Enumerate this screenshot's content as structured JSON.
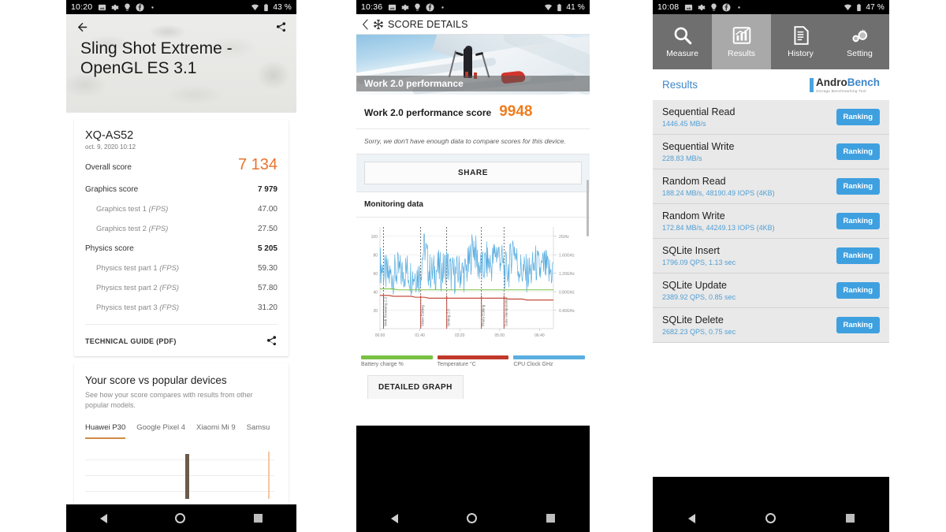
{
  "phone1": {
    "status": {
      "time": "10:20",
      "battery": "43 %",
      "icons": [
        "image-icon",
        "gear-icon",
        "bulb-icon",
        "facebook-icon",
        "dot-icon"
      ],
      "right_icons": [
        "wifi-icon",
        "battery-icon"
      ]
    },
    "appbar": {
      "back": "back-arrow-icon",
      "share": "share-icon"
    },
    "title": "Sling Shot Extreme - OpenGL ES 3.1",
    "device": {
      "name": "XQ-AS52",
      "date": "oct. 9, 2020 10:12"
    },
    "scores": [
      {
        "label": "Overall score",
        "value": "7 134",
        "type": "overall"
      },
      {
        "label": "Graphics score",
        "value": "7 979",
        "type": "main"
      },
      {
        "label": "Graphics test 1",
        "unit": "(FPS)",
        "value": "47.00",
        "type": "sub"
      },
      {
        "label": "Graphics test 2",
        "unit": "(FPS)",
        "value": "27.50",
        "type": "sub"
      },
      {
        "label": "Physics score",
        "value": "5 205",
        "type": "main"
      },
      {
        "label": "Physics test part 1",
        "unit": "(FPS)",
        "value": "59.30",
        "type": "sub"
      },
      {
        "label": "Physics test part 2",
        "unit": "(FPS)",
        "value": "57.80",
        "type": "sub"
      },
      {
        "label": "Physics test part 3",
        "unit": "(FPS)",
        "value": "31.20",
        "type": "sub"
      }
    ],
    "technical_guide": "TECHNICAL GUIDE (PDF)",
    "compare": {
      "title": "Your score vs popular devices",
      "subtitle": "See how your score compares with results from other popular models.",
      "tabs": [
        "Huawei P30",
        "Google Pixel 4",
        "Xiaomi Mi 9",
        "Samsu"
      ],
      "active_tab": "Huawei P30"
    },
    "accent": "#e8742c"
  },
  "phone2": {
    "status": {
      "time": "10:36",
      "battery": "41 %"
    },
    "appbar": {
      "back": "chevron-left-icon",
      "logo": "snowflake-icon",
      "title": "SCORE DETAILS"
    },
    "hero_caption": "Work 2.0 performance",
    "score": {
      "label": "Work 2.0 performance score",
      "value": "9948"
    },
    "note": "Sorry, we don't have enough data to compare scores for this device.",
    "share_label": "SHARE",
    "monitoring_label": "Monitoring data",
    "detailed_graph_label": "DETAILED GRAPH",
    "accent": "#f07c1e",
    "chart_data": {
      "type": "line",
      "title": "Monitoring data",
      "xlabel": "",
      "ylabel": "",
      "grid": true,
      "legend_position": "bottom",
      "x_ticks": [
        "00:00",
        "01:40",
        "03:20",
        "05:00",
        "06:40"
      ],
      "y_left_ticks": [
        20,
        40,
        60,
        80,
        100
      ],
      "y_left_range": [
        0,
        110
      ],
      "y_right_ticks": [
        "0.40GHz",
        "0.80GHz",
        "1.20GHz",
        "1.60GHz",
        "2GHz"
      ],
      "y_right_range": [
        0,
        2.2
      ],
      "annotations": [
        "Web Browsing 2.0",
        "Video Editing",
        "Writing 2.0",
        "Photo Editing",
        "Data Manipulation"
      ],
      "series": [
        {
          "name": "Battery charge %",
          "color": "#7ac143",
          "type": "step",
          "values": [
            43,
            43,
            43,
            43,
            42,
            42,
            42,
            42,
            42,
            42,
            42,
            42,
            42,
            42,
            42,
            42,
            42,
            42,
            42,
            42,
            42,
            42,
            42,
            42,
            42,
            42,
            42,
            42,
            42,
            42,
            42,
            42,
            42,
            42,
            42,
            42,
            42,
            42,
            42,
            42
          ]
        },
        {
          "name": "Temperature °C",
          "color": "#c0392b",
          "type": "step",
          "values": [
            36,
            36,
            36,
            35,
            35,
            35,
            35,
            35,
            34,
            34,
            34,
            33,
            33,
            33,
            33,
            33,
            33,
            33,
            33,
            33,
            33,
            33,
            33,
            33,
            33,
            33,
            33,
            33,
            33,
            32,
            32,
            32,
            32,
            31,
            31,
            31,
            31,
            31,
            31,
            31
          ]
        },
        {
          "name": "CPU Clock GHz",
          "color": "#5aaee0",
          "type": "spiky",
          "values": [
            1.2,
            0.8,
            0.7,
            0.75,
            0.9,
            0.8,
            0.95,
            0.7,
            0.8,
            0.75,
            2.0,
            0.9,
            0.8,
            1.0,
            0.85,
            1.2,
            0.8,
            0.75,
            0.9,
            0.8,
            1.15,
            2.0,
            1.2,
            0.9,
            1.3,
            1.1,
            1.7,
            1.5,
            0.9,
            1.0,
            2.0,
            1.1,
            0.9,
            0.8,
            0.85,
            1.2,
            0.9,
            1.1,
            0.8,
            1.0
          ]
        }
      ]
    }
  },
  "phone3": {
    "status": {
      "time": "10:08",
      "battery": "47 %"
    },
    "nav": [
      {
        "label": "Measure",
        "icon": "magnifier-icon",
        "active": false
      },
      {
        "label": "Results",
        "icon": "bar-chart-icon",
        "active": true
      },
      {
        "label": "History",
        "icon": "document-icon",
        "active": false
      },
      {
        "label": "Setting",
        "icon": "gears-icon",
        "active": false
      }
    ],
    "section_title": "Results",
    "logo": {
      "name_a": "Andro",
      "name_b": "Bench",
      "tagline": "Storage Benchmarking Tool"
    },
    "rows": [
      {
        "name": "Sequential Read",
        "detail": "1446.45 MB/s",
        "action": "Ranking"
      },
      {
        "name": "Sequential Write",
        "detail": "228.83 MB/s",
        "action": "Ranking"
      },
      {
        "name": "Random Read",
        "detail": "188.24 MB/s, 48190.49 IOPS (4KB)",
        "action": "Ranking"
      },
      {
        "name": "Random Write",
        "detail": "172.84 MB/s, 44249.13 IOPS (4KB)",
        "action": "Ranking"
      },
      {
        "name": "SQLite Insert",
        "detail": "1796.09 QPS, 1.13 sec",
        "action": "Ranking"
      },
      {
        "name": "SQLite Update",
        "detail": "2389.92 QPS, 0.85 sec",
        "action": "Ranking"
      },
      {
        "name": "SQLite Delete",
        "detail": "2682.23 QPS, 0.75 sec",
        "action": "Ranking"
      }
    ],
    "accent": "#3fa0e0"
  }
}
